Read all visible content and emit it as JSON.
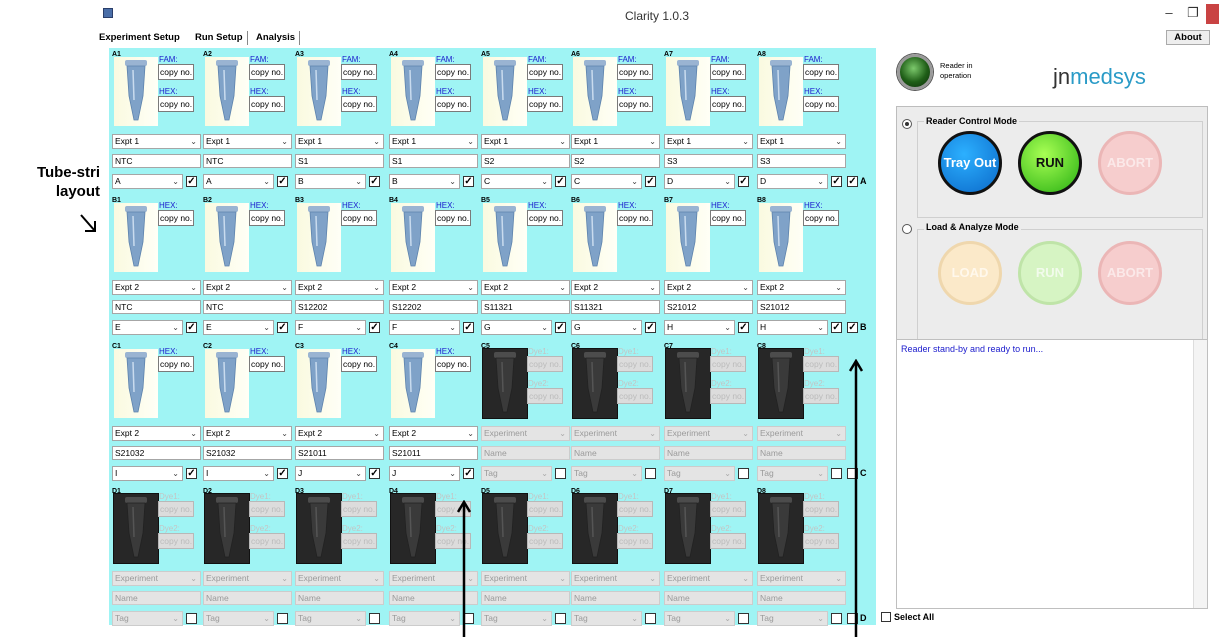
{
  "window": {
    "title": "Clarity 1.0.3",
    "min_icon": "minimize-icon",
    "max_icon": "restore-icon",
    "close_icon": "close-icon"
  },
  "tabs": {
    "experiment_setup": "Experiment Setup",
    "run_setup": "Run Setup",
    "analysis": "Analysis",
    "active": "Run Setup"
  },
  "about_label": "About",
  "annotation": {
    "label": "Tube-stri layout"
  },
  "rows": [
    {
      "id": "A",
      "checked": true,
      "wells": [
        {
          "id": "A1",
          "state": "active",
          "dyes": [
            "FAM:",
            "HEX:"
          ],
          "copies": [
            "copy no.",
            "copy no."
          ],
          "experiment": "Expt 1",
          "name": "NTC",
          "tag": "A",
          "checked": true
        },
        {
          "id": "A2",
          "state": "active",
          "dyes": [
            "FAM:",
            "HEX:"
          ],
          "copies": [
            "copy no.",
            "copy no."
          ],
          "experiment": "Expt 1",
          "name": "NTC",
          "tag": "A",
          "checked": true
        },
        {
          "id": "A3",
          "state": "active",
          "dyes": [
            "FAM:",
            "HEX:"
          ],
          "copies": [
            "copy no.",
            "copy no."
          ],
          "experiment": "Expt 1",
          "name": "S1",
          "tag": "B",
          "checked": true
        },
        {
          "id": "A4",
          "state": "active",
          "dyes": [
            "FAM:",
            "HEX:"
          ],
          "copies": [
            "copy no.",
            "copy no."
          ],
          "experiment": "Expt 1",
          "name": "S1",
          "tag": "B",
          "checked": true
        },
        {
          "id": "A5",
          "state": "active",
          "dyes": [
            "FAM:",
            "HEX:"
          ],
          "copies": [
            "copy no.",
            "copy no."
          ],
          "experiment": "Expt 1",
          "name": "S2",
          "tag": "C",
          "checked": true
        },
        {
          "id": "A6",
          "state": "active",
          "dyes": [
            "FAM:",
            "HEX:"
          ],
          "copies": [
            "copy no.",
            "copy no."
          ],
          "experiment": "Expt 1",
          "name": "S2",
          "tag": "C",
          "checked": true
        },
        {
          "id": "A7",
          "state": "active",
          "dyes": [
            "FAM:",
            "HEX:"
          ],
          "copies": [
            "copy no.",
            "copy no."
          ],
          "experiment": "Expt 1",
          "name": "S3",
          "tag": "D",
          "checked": true
        },
        {
          "id": "A8",
          "state": "active",
          "dyes": [
            "FAM:",
            "HEX:"
          ],
          "copies": [
            "copy no.",
            "copy no."
          ],
          "experiment": "Expt 1",
          "name": "S3",
          "tag": "D",
          "checked": true
        }
      ]
    },
    {
      "id": "B",
      "checked": true,
      "wells": [
        {
          "id": "B1",
          "state": "active",
          "dyes": [
            "HEX:"
          ],
          "copies": [
            "copy no."
          ],
          "experiment": "Expt 2",
          "name": "NTC",
          "tag": "E",
          "checked": true
        },
        {
          "id": "B2",
          "state": "active",
          "dyes": [
            "HEX:"
          ],
          "copies": [
            "copy no."
          ],
          "experiment": "Expt 2",
          "name": "NTC",
          "tag": "E",
          "checked": true
        },
        {
          "id": "B3",
          "state": "active",
          "dyes": [
            "HEX:"
          ],
          "copies": [
            "copy no."
          ],
          "experiment": "Expt 2",
          "name": "S12202",
          "tag": "F",
          "checked": true
        },
        {
          "id": "B4",
          "state": "active",
          "dyes": [
            "HEX:"
          ],
          "copies": [
            "copy no."
          ],
          "experiment": "Expt 2",
          "name": "S12202",
          "tag": "F",
          "checked": true
        },
        {
          "id": "B5",
          "state": "active",
          "dyes": [
            "HEX:"
          ],
          "copies": [
            "copy no."
          ],
          "experiment": "Expt 2",
          "name": "S11321",
          "tag": "G",
          "checked": true
        },
        {
          "id": "B6",
          "state": "active",
          "dyes": [
            "HEX:"
          ],
          "copies": [
            "copy no."
          ],
          "experiment": "Expt 2",
          "name": "S11321",
          "tag": "G",
          "checked": true
        },
        {
          "id": "B7",
          "state": "active",
          "dyes": [
            "HEX:"
          ],
          "copies": [
            "copy no."
          ],
          "experiment": "Expt 2",
          "name": "S21012",
          "tag": "H",
          "checked": true
        },
        {
          "id": "B8",
          "state": "active",
          "dyes": [
            "HEX:"
          ],
          "copies": [
            "copy no."
          ],
          "experiment": "Expt 2",
          "name": "S21012",
          "tag": "H",
          "checked": true
        }
      ]
    },
    {
      "id": "C",
      "checked": false,
      "wells": [
        {
          "id": "C1",
          "state": "active",
          "dyes": [
            "HEX:"
          ],
          "copies": [
            "copy no."
          ],
          "experiment": "Expt 2",
          "name": "S21032",
          "tag": "I",
          "checked": true
        },
        {
          "id": "C2",
          "state": "active",
          "dyes": [
            "HEX:"
          ],
          "copies": [
            "copy no."
          ],
          "experiment": "Expt 2",
          "name": "S21032",
          "tag": "I",
          "checked": true
        },
        {
          "id": "C3",
          "state": "active",
          "dyes": [
            "HEX:"
          ],
          "copies": [
            "copy no."
          ],
          "experiment": "Expt 2",
          "name": "S21011",
          "tag": "J",
          "checked": true
        },
        {
          "id": "C4",
          "state": "active",
          "dyes": [
            "HEX:"
          ],
          "copies": [
            "copy no."
          ],
          "experiment": "Expt 2",
          "name": "S21011",
          "tag": "J",
          "checked": true
        },
        {
          "id": "C5",
          "state": "inactive",
          "dyes": [
            "Dye1:",
            "Dye2:"
          ],
          "copies": [
            "copy no.",
            "copy no."
          ],
          "experiment": "Experiment",
          "name": "Name",
          "tag": "Tag",
          "checked": false
        },
        {
          "id": "C6",
          "state": "inactive",
          "dyes": [
            "Dye1:",
            "Dye2:"
          ],
          "copies": [
            "copy no.",
            "copy no."
          ],
          "experiment": "Experiment",
          "name": "Name",
          "tag": "Tag",
          "checked": false
        },
        {
          "id": "C7",
          "state": "inactive",
          "dyes": [
            "Dye1:",
            "Dye2:"
          ],
          "copies": [
            "copy no.",
            "copy no."
          ],
          "experiment": "Experiment",
          "name": "Name",
          "tag": "Tag",
          "checked": false
        },
        {
          "id": "C8",
          "state": "inactive",
          "dyes": [
            "Dye1:",
            "Dye2:"
          ],
          "copies": [
            "copy no.",
            "copy no."
          ],
          "experiment": "Experiment",
          "name": "Name",
          "tag": "Tag",
          "checked": false
        }
      ]
    },
    {
      "id": "D",
      "checked": false,
      "wells": [
        {
          "id": "D1",
          "state": "inactive",
          "dyes": [
            "Dye1:",
            "Dye2:"
          ],
          "copies": [
            "copy no.",
            "copy no."
          ],
          "experiment": "Experiment",
          "name": "Name",
          "tag": "Tag",
          "checked": false
        },
        {
          "id": "D2",
          "state": "inactive",
          "dyes": [
            "Dye1:",
            "Dye2:"
          ],
          "copies": [
            "copy no.",
            "copy no."
          ],
          "experiment": "Experiment",
          "name": "Name",
          "tag": "Tag",
          "checked": false
        },
        {
          "id": "D3",
          "state": "inactive",
          "dyes": [
            "Dye1:",
            "Dye2:"
          ],
          "copies": [
            "copy no.",
            "copy no."
          ],
          "experiment": "Experiment",
          "name": "Name",
          "tag": "Tag",
          "checked": false
        },
        {
          "id": "D4",
          "state": "inactive",
          "dyes": [
            "Dye1:",
            "Dye2:"
          ],
          "copies": [
            "copy no.",
            "copy no."
          ],
          "experiment": "Experiment",
          "name": "Name",
          "tag": "Tag",
          "checked": false
        },
        {
          "id": "D5",
          "state": "inactive",
          "dyes": [
            "Dye1:",
            "Dye2:"
          ],
          "copies": [
            "copy no.",
            "copy no."
          ],
          "experiment": "Experiment",
          "name": "Name",
          "tag": "Tag",
          "checked": false
        },
        {
          "id": "D6",
          "state": "inactive",
          "dyes": [
            "Dye1:",
            "Dye2:"
          ],
          "copies": [
            "copy no.",
            "copy no."
          ],
          "experiment": "Experiment",
          "name": "Name",
          "tag": "Tag",
          "checked": false
        },
        {
          "id": "D7",
          "state": "inactive",
          "dyes": [
            "Dye1:",
            "Dye2:"
          ],
          "copies": [
            "copy no.",
            "copy no."
          ],
          "experiment": "Experiment",
          "name": "Name",
          "tag": "Tag",
          "checked": false
        },
        {
          "id": "D8",
          "state": "inactive",
          "dyes": [
            "Dye1:",
            "Dye2:"
          ],
          "copies": [
            "copy no.",
            "copy no."
          ],
          "experiment": "Experiment",
          "name": "Name",
          "tag": "Tag",
          "checked": false
        }
      ]
    }
  ],
  "select_all": {
    "label": "Select All",
    "checked": false
  },
  "sidebar": {
    "brand_prefix": "jn",
    "brand_suffix": "medsys",
    "reader_status": "Reader in operation",
    "reader_led_icon": "status-led-icon",
    "reader_mode": {
      "label": "Reader Control Mode",
      "selected": true,
      "buttons": {
        "tray_out": "Tray Out",
        "run": "RUN",
        "abort": "ABORT"
      }
    },
    "load_mode": {
      "label": "Load & Analyze Mode",
      "selected": false,
      "buttons": {
        "load": "LOAD",
        "run": "RUN",
        "abort": "ABORT"
      }
    },
    "log": "Reader stand-by and ready to run..."
  },
  "colors": {
    "grid_bg": "#9ff4f4",
    "accent_blue": "#1a1acc",
    "brand": "#2a9bc7",
    "close": "#c94343"
  }
}
